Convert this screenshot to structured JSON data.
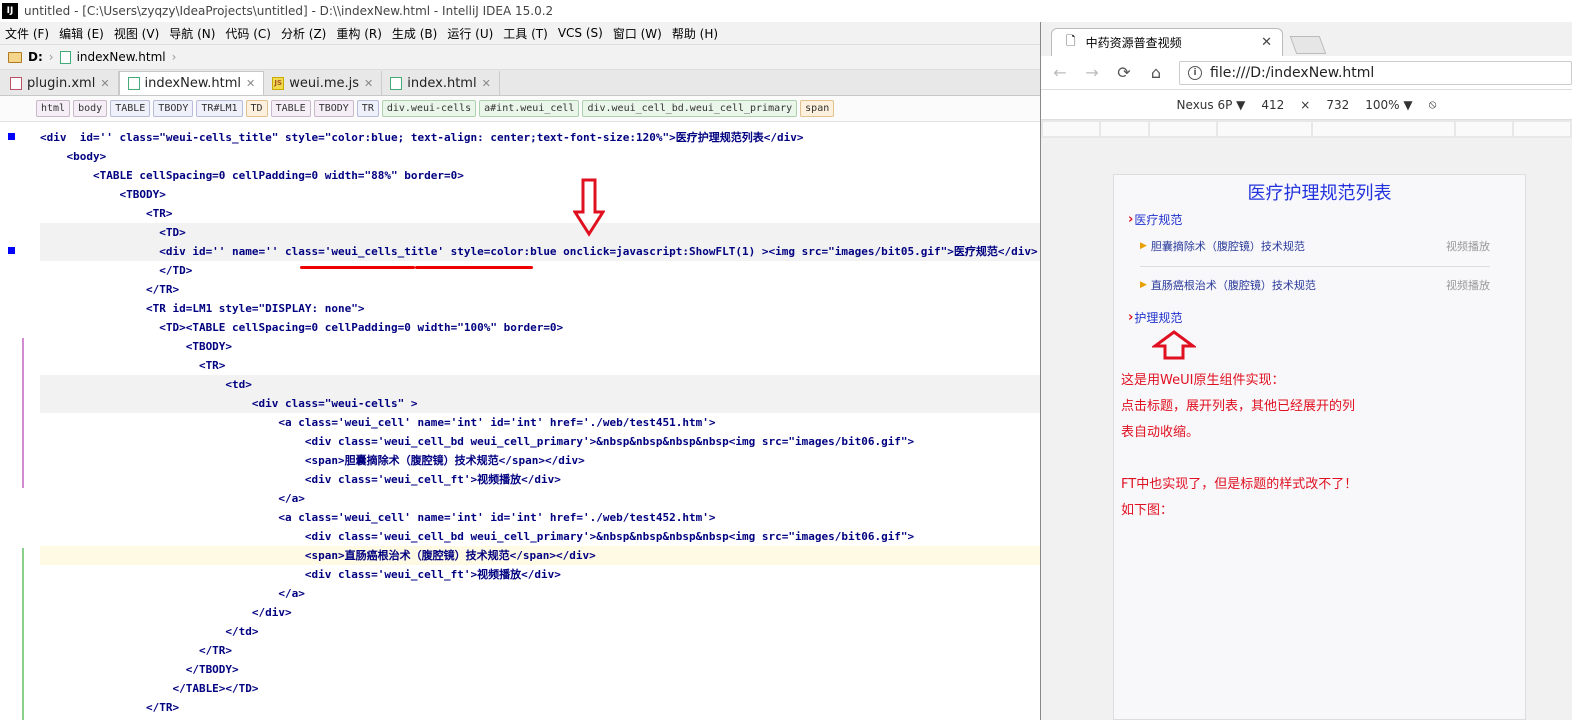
{
  "window": {
    "title": "untitled - [C:\\Users\\zyqzy\\IdeaProjects\\untitled] - D:\\\\indexNew.html - IntelliJ IDEA 15.0.2",
    "logo": "IJ"
  },
  "menu": [
    "文件 (F)",
    "编辑 (E)",
    "视图 (V)",
    "导航 (N)",
    "代码 (C)",
    "分析 (Z)",
    "重构 (R)",
    "生成 (B)",
    "运行 (U)",
    "工具 (T)",
    "VCS (S)",
    "窗口 (W)",
    "帮助 (H)"
  ],
  "nav": {
    "drive": "D:",
    "file": "indexNew.html"
  },
  "tabs": [
    {
      "label": "plugin.xml",
      "icon": "xml-file-icon",
      "active": false
    },
    {
      "label": "indexNew.html",
      "icon": "html-file-icon",
      "active": true
    },
    {
      "label": "weui.me.js",
      "icon": "js-file-icon",
      "active": false
    },
    {
      "label": "index.html",
      "icon": "html-file-icon",
      "active": false
    }
  ],
  "breadcrumbs": [
    "html",
    "body",
    "TABLE",
    "TBODY",
    "TR#LM1",
    "TD",
    "TABLE",
    "TBODY",
    "TR",
    "div.weui-cells",
    "a#int.weui_cell",
    "div.weui_cell_bd.weui_cell_primary",
    "span"
  ],
  "code": [
    "<div  id='' class=\"weui-cells_title\" style=\"color:blue; text-align: center;text-font-size:120%\">医疗护理规范列表</div>",
    "    <body>",
    "        <TABLE cellSpacing=0 cellPadding=0 width=\"88%\" border=0>",
    "            <TBODY>",
    "                <TR>",
    "                  <TD>",
    "                  <div id='' name='' class='weui_cells_title' style=color:blue onclick=javascript:ShowFLT(1) ><img src=\"images/bit05.gif\">医疗规范</div>",
    "                  </TD>",
    "                </TR>",
    "                <TR id=LM1 style=\"DISPLAY: none\">",
    "                  <TD><TABLE cellSpacing=0 cellPadding=0 width=\"100%\" border=0>",
    "                      <TBODY>",
    "                        <TR>",
    "                            <td>",
    "                                <div class=\"weui-cells\" >",
    "                                    <a class='weui_cell' name='int' id='int' href='./web/test451.htm'>",
    "                                        <div class='weui_cell_bd weui_cell_primary'>&nbsp&nbsp&nbsp&nbsp<img src=\"images/bit06.gif\">",
    "                                        <span>胆囊摘除术（腹腔镜）技术规范</span></div>",
    "                                        <div class='weui_cell_ft'>视频播放</div>",
    "                                    </a>",
    "                                    <a class='weui_cell' name='int' id='int' href='./web/test452.htm'>",
    "                                        <div class='weui_cell_bd weui_cell_primary'>&nbsp&nbsp&nbsp&nbsp<img src=\"images/bit06.gif\">",
    "                                        <span>直肠癌根治术（腹腔镜）技术规范</span></div>",
    "                                        <div class='weui_cell_ft'>视频播放</div>",
    "                                    </a>",
    "                                </div>",
    "                            </td>",
    "                        </TR>",
    "                      </TBODY>",
    "                    </TABLE></TD>",
    "                </TR>"
  ],
  "browser": {
    "tab_title": "中药资源普查视频",
    "url": "file:///D:/indexNew.html",
    "device": "Nexus 6P ▼",
    "width": "412",
    "times": "×",
    "height": "732",
    "zoom": "100% ▼"
  },
  "page": {
    "title": "医疗护理规范列表",
    "section1": "医疗规范",
    "items": [
      {
        "label": "胆囊摘除术（腹腔镜）技术规范",
        "action": "视频播放"
      },
      {
        "label": "直肠癌根治术（腹腔镜）技术规范",
        "action": "视频播放"
      }
    ],
    "section2": "护理规范",
    "notes": [
      "这是用WeUI原生组件实现：",
      "点击标题，展开列表，其他已经展开的列",
      "表自动收缩。",
      "",
      "FT中也实现了，但是标题的样式改不了！",
      "如下图："
    ]
  },
  "colors": {
    "annotation_red": "#e01020",
    "link_blue": "#2233dd"
  }
}
